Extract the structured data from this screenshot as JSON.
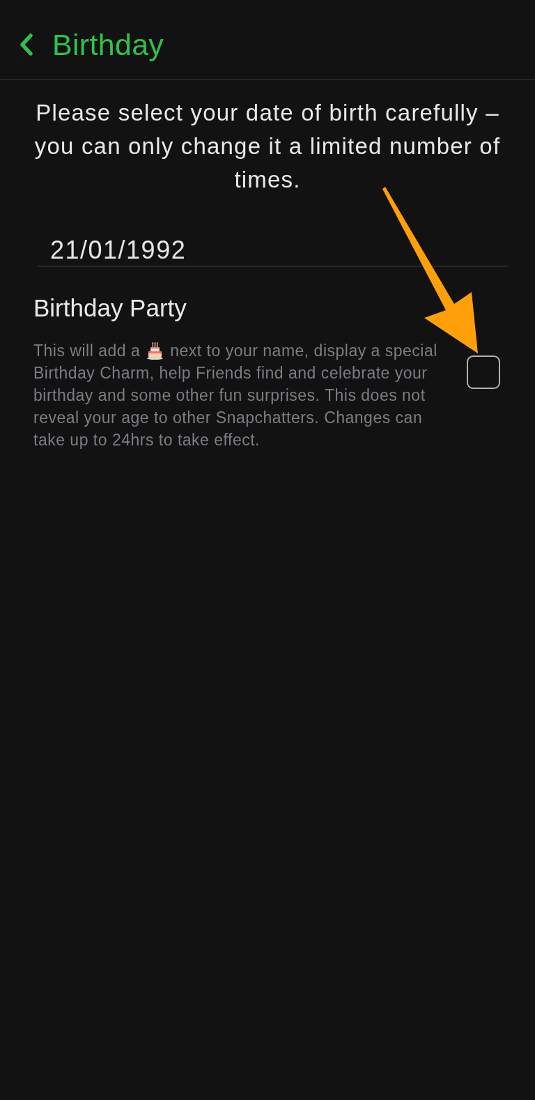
{
  "header": {
    "title": "Birthday"
  },
  "intro": "Please select your date of birth carefully – you can only change it a limited number of times.",
  "date_field": {
    "value": "21/01/1992"
  },
  "birthday_party": {
    "title": "Birthday Party",
    "description_start": "This will add a",
    "description_after_icon": "next to your name, display a special",
    "description_rest": "Birthday Charm, help Friends find and celebrate your birthday and some other fun surprises. This does not reveal your age to other Snapchatters. Changes can take up to 24hrs to take effect.",
    "checked": false
  }
}
